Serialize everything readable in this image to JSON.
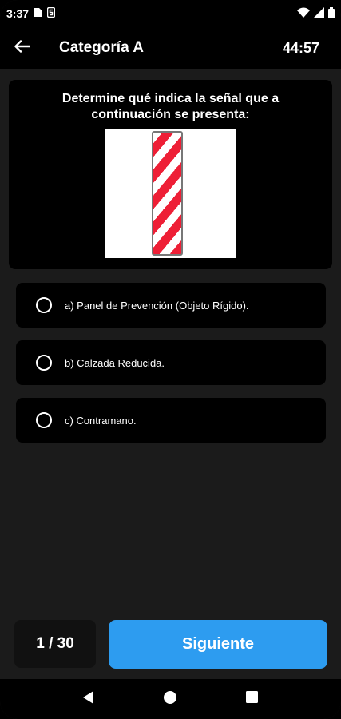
{
  "status_bar": {
    "time": "3:37",
    "icons": [
      "sim-icon",
      "s-notification-icon",
      "wifi-icon",
      "signal-icon",
      "battery-icon"
    ]
  },
  "app_bar": {
    "back_icon": "arrow-left-icon",
    "title": "Categoría A",
    "timer": "44:57"
  },
  "question": {
    "text": "Determine qué indica la señal que a continuación se presenta:",
    "image": "red-white-striped-rigid-object-marker"
  },
  "options": [
    {
      "label": "a) Panel de Prevención (Objeto Rígido).",
      "selected": false
    },
    {
      "label": "b) Calzada Reducida.",
      "selected": false
    },
    {
      "label": "c) Contramano.",
      "selected": false
    }
  ],
  "footer": {
    "counter": "1 / 30",
    "next_label": "Siguiente"
  },
  "nav_bar": {
    "icons": [
      "back-triangle-icon",
      "home-circle-icon",
      "recents-square-icon"
    ]
  },
  "colors": {
    "accent": "#2d9cf0",
    "background": "#1b1b1b",
    "card": "#000000",
    "stripe_red": "#ee1f36"
  }
}
